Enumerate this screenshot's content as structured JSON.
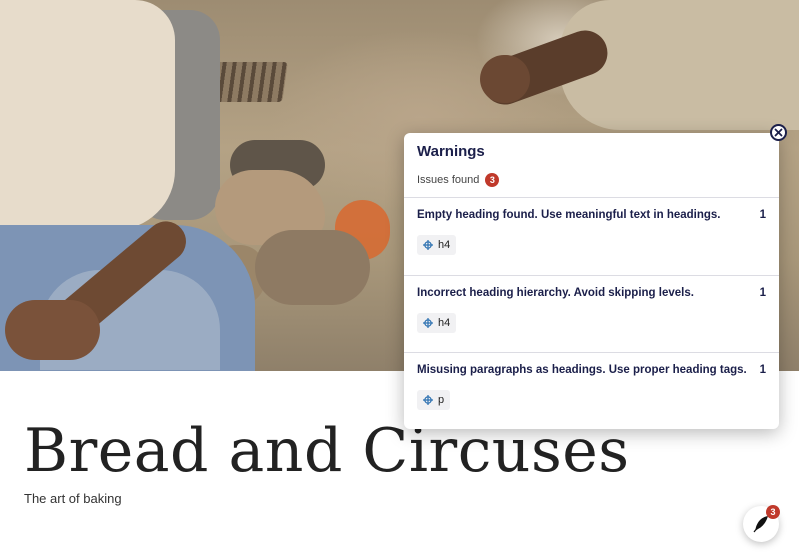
{
  "page": {
    "title": "Bread and Circuses",
    "subtitle": "The art of baking"
  },
  "warnings": {
    "title": "Warnings",
    "issues_label": "Issues found",
    "issues_count": "3",
    "items": [
      {
        "message": "Empty heading found. Use meaningful text in headings.",
        "count": "1",
        "tag": "h4"
      },
      {
        "message": "Incorrect heading hierarchy. Avoid skipping levels.",
        "count": "1",
        "tag": "h4"
      },
      {
        "message": "Misusing paragraphs as headings. Use proper heading tags.",
        "count": "1",
        "tag": "p"
      }
    ]
  },
  "fab": {
    "badge_count": "3",
    "icon": "quill-pen-icon"
  },
  "colors": {
    "accent": "#1b1f4a",
    "badge": "#c0392b"
  }
}
